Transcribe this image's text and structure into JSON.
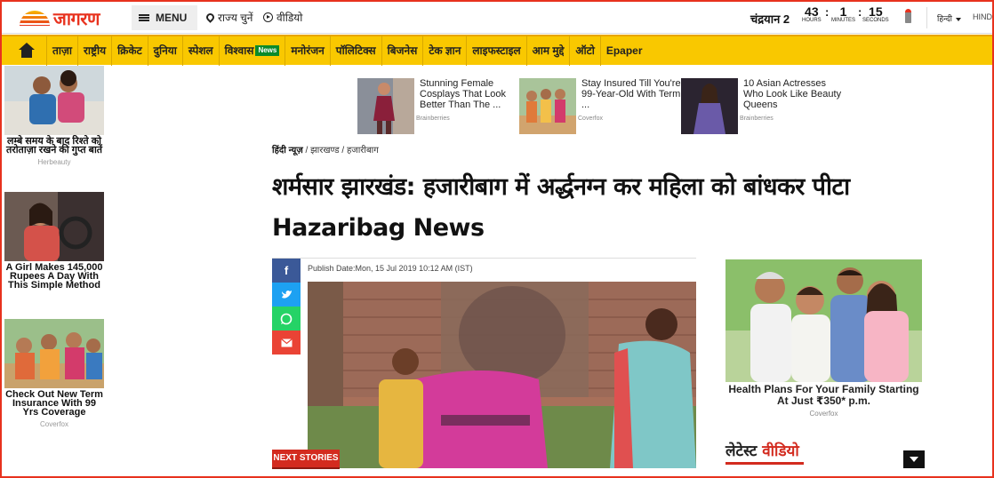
{
  "header": {
    "logo_text": "जागरण",
    "menu_label": "MENU",
    "state_select": "राज्य चुनें",
    "video_link": "वीडियो",
    "event_label": "चंद्रयान 2",
    "countdown": {
      "hours": "43",
      "minutes": "1",
      "seconds": "15",
      "hours_unit": "HOURS",
      "minutes_unit": "MINUTES",
      "seconds_unit": "SECONDS"
    },
    "lang_select": "हिन्दी",
    "lang_alt": "HINDI"
  },
  "nav": {
    "items": [
      "ताज़ा",
      "राष्ट्रीय",
      "क्रिकेट",
      "दुनिया",
      "स्पेशल",
      "विश्वास",
      "मनोरंजन",
      "पॉलिटिक्स",
      "बिजनेस",
      "टेक ज्ञान",
      "लाइफस्टाइल",
      "आम मुद्दे",
      "ऑटो",
      "Epaper"
    ],
    "news_badge": "News"
  },
  "left_ads": [
    {
      "caption": "लम्बे समय के बाद रिश्ते को तरोताज़ा रखने की गुप्त बातें",
      "source": "Herbeauty"
    },
    {
      "caption": "A Girl Makes 145,000 Rupees A Day With This Simple Method",
      "source": ""
    },
    {
      "caption": "Check Out New Term Insurance With 99 Yrs Coverage",
      "source": "Coverfox"
    }
  ],
  "top_ads": [
    {
      "title": "Stunning Female Cosplays That Look Better Than The ...",
      "source": "Brainberries"
    },
    {
      "title": "Stay Insured Till You're 99-Year-Old With Term ...",
      "source": "Coverfox"
    },
    {
      "title": "10 Asian Actresses Who Look Like Beauty Queens",
      "source": "Brainberries"
    }
  ],
  "breadcrumb": {
    "home": "हिंदी न्यूज़",
    "sep": "/",
    "level1": "झारखण्ड",
    "level2": "हजारीबाग"
  },
  "article": {
    "title": "शर्मसार झारखंड: हजारीबाग में अर्द्धनग्न कर महिला को बांधकर पीटा Hazaribag News",
    "publish_date": "Publish Date:Mon, 15 Jul 2019 10:12 AM (IST)",
    "share_facebook": "f",
    "share_twitter": "t",
    "share_whatsapp": "w",
    "share_email": "m"
  },
  "next_stories_label": "NEXT STORIES",
  "right_ad": {
    "caption": "Health Plans For Your Family Starting At Just ₹350* p.m.",
    "source": "Coverfox"
  },
  "latest_videos": {
    "part1": "लेटेस्ट",
    "part2": "वीडियो"
  },
  "colors": {
    "accent": "#e8321e",
    "nav_bg": "#f9c800",
    "facebook": "#3b5998",
    "twitter": "#1da1f2",
    "whatsapp": "#25d366",
    "email": "#ea4335"
  }
}
